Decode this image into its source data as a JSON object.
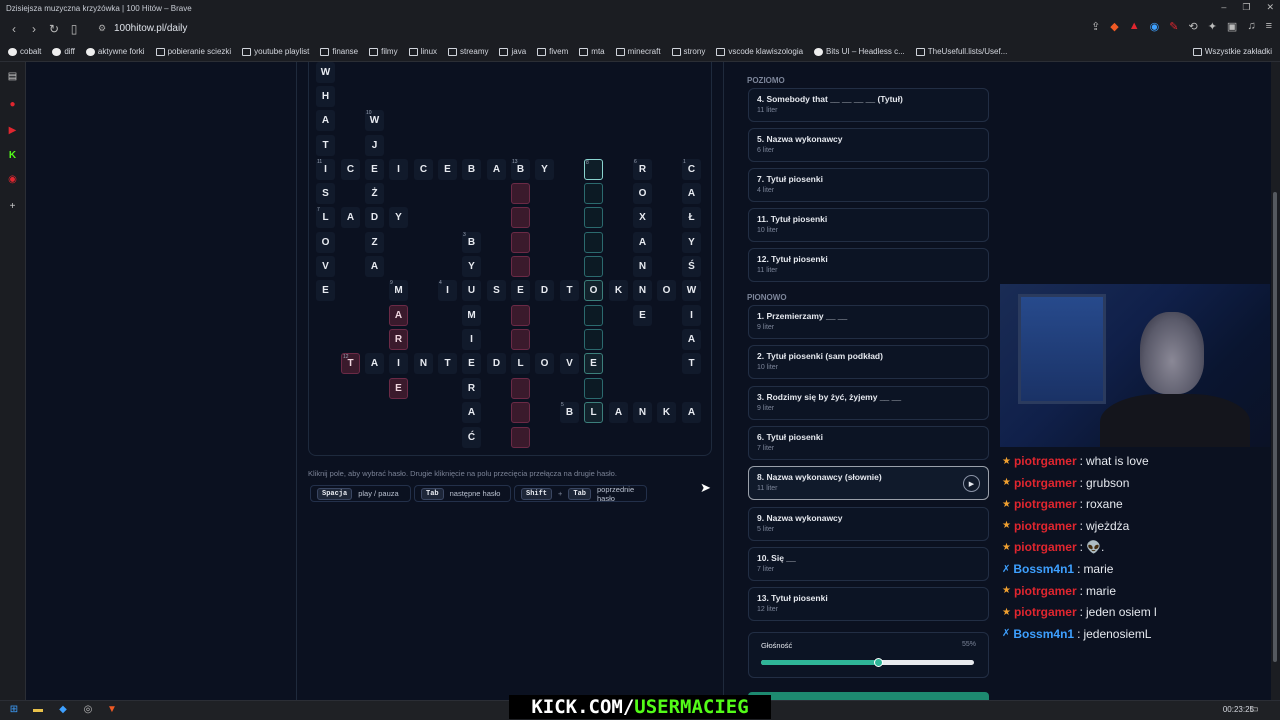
{
  "window": {
    "title": "Dzisiejsza muzyczna krzyżówka | 100 Hitów – Brave"
  },
  "address": {
    "url": "100hitow.pl/daily"
  },
  "bookmarks": [
    "cobalt",
    "diff",
    "aktywne forki",
    "pobieranie sciezki",
    "youtube playlist",
    "finanse",
    "filmy",
    "linux",
    "streamy",
    "java",
    "fivem",
    "mta",
    "minecraft",
    "strony",
    "vscode klawiszologia",
    "Bits UI – Headless c...",
    "TheUsefull.lists/Usef...",
    "Wszystkie zakładki"
  ],
  "grid": {
    "cells": [
      {
        "l": "W"
      },
      {
        "l": "H"
      },
      {
        "l": "A"
      },
      {
        "l": "T"
      },
      {
        "l": "W",
        "n": "10"
      },
      {
        "l": "J"
      },
      {
        "l": "I",
        "n": "11"
      },
      {
        "l": "C"
      },
      {
        "l": "E"
      },
      {
        "l": "I"
      },
      {
        "l": "C"
      },
      {
        "l": "E"
      },
      {
        "l": "B"
      },
      {
        "l": "A"
      },
      {
        "l": "B",
        "n": "13"
      },
      {
        "l": "Y"
      },
      {
        "l": "S"
      },
      {
        "l": "Ż"
      },
      {
        "l": "O"
      },
      {
        "l": "Z"
      },
      {
        "l": "V"
      },
      {
        "l": "A"
      },
      {
        "l": "E"
      },
      {
        "l": "L",
        "n": "7"
      },
      {
        "l": "A"
      },
      {
        "l": "D"
      },
      {
        "l": "Y"
      },
      {
        "l": "R",
        "n": "6"
      },
      {
        "l": "O"
      },
      {
        "l": "X"
      },
      {
        "l": "A"
      },
      {
        "l": "N"
      },
      {
        "l": "E"
      },
      {
        "l": "C",
        "n": "1"
      },
      {
        "l": "A"
      },
      {
        "l": "Ł"
      },
      {
        "l": "Y"
      },
      {
        "l": "Ś"
      },
      {
        "l": "W"
      },
      {
        "l": "I"
      },
      {
        "l": "A"
      },
      {
        "l": "T"
      },
      {
        "l": "B",
        "n": "3"
      },
      {
        "l": "Y"
      },
      {
        "l": "M"
      },
      {
        "l": "I"
      },
      {
        "l": "R"
      },
      {
        "l": "A"
      },
      {
        "l": "Ć"
      },
      {
        "l": "I",
        "n": "4"
      },
      {
        "l": "U"
      },
      {
        "l": "S"
      },
      {
        "l": "E"
      },
      {
        "l": "D"
      },
      {
        "l": "T"
      },
      {
        "l": "O"
      },
      {
        "l": "K"
      },
      {
        "l": "N"
      },
      {
        "l": "O"
      },
      {
        "l": "M",
        "n": "9"
      },
      {
        "l": "A"
      },
      {
        "l": "R"
      },
      {
        "l": "E"
      },
      {
        "l": "T",
        "n": "12"
      },
      {
        "l": "A"
      },
      {
        "l": "I"
      },
      {
        "l": "N"
      },
      {
        "l": "T"
      },
      {
        "l": "E"
      },
      {
        "l": "D"
      },
      {
        "l": "L"
      },
      {
        "l": "O"
      },
      {
        "l": "V"
      },
      {
        "l": "E"
      },
      {
        "l": "B",
        "n": "5"
      },
      {
        "l": "L"
      },
      {
        "l": "A"
      },
      {
        "l": "N"
      },
      {
        "l": "K"
      },
      {
        "l": "A"
      },
      {
        "l": "",
        "n": "8"
      }
    ]
  },
  "hint": "Kliknij pole, aby wybrać hasło. Drugie kliknięcie na polu przecięcia przełącza na drugie hasło.",
  "shortcuts": [
    {
      "keys": [
        "Spacja"
      ],
      "label": "play / pauza"
    },
    {
      "keys": [
        "Tab"
      ],
      "label": "następne hasło"
    },
    {
      "keys": [
        "Shift",
        "Tab"
      ],
      "label": "poprzednie hasło"
    }
  ],
  "clues": {
    "across_title": "POZIOMO",
    "across": [
      {
        "t": "4. Somebody that __ __ __ __ (Tytuł)",
        "s": "11 liter"
      },
      {
        "t": "5. Nazwa wykonawcy",
        "s": "6 liter"
      },
      {
        "t": "7. Tytuł piosenki",
        "s": "4 liter"
      },
      {
        "t": "11. Tytuł piosenki",
        "s": "10 liter"
      },
      {
        "t": "12. Tytuł piosenki",
        "s": "11 liter"
      }
    ],
    "down_title": "PIONOWO",
    "down": [
      {
        "t": "1. Przemierzamy __ __",
        "s": "9 liter"
      },
      {
        "t": "2. Tytuł piosenki (sam podkład)",
        "s": "10 liter"
      },
      {
        "t": "3. Rodzimy się by żyć, żyjemy __ __",
        "s": "9 liter"
      },
      {
        "t": "6. Tytuł piosenki",
        "s": "7 liter"
      },
      {
        "t": "8. Nazwa wykonawcy (słownie)",
        "s": "11 liter"
      },
      {
        "t": "9. Nazwa wykonawcy",
        "s": "5 liter"
      },
      {
        "t": "10. Się __",
        "s": "7 liter"
      },
      {
        "t": "13. Tytuł piosenki",
        "s": "12 liter"
      }
    ]
  },
  "volume": {
    "label": "Głośność",
    "value_text": "55%",
    "value": 0.55
  },
  "chat": [
    {
      "user": "piotrgamer",
      "text": "what is love",
      "color": "#e0262f",
      "icon": "★"
    },
    {
      "user": "piotrgamer",
      "text": "grubson",
      "color": "#e0262f",
      "icon": "★"
    },
    {
      "user": "piotrgamer",
      "text": "roxane",
      "color": "#e0262f",
      "icon": "★"
    },
    {
      "user": "piotrgamer",
      "text": "wjeżdża",
      "color": "#e0262f",
      "icon": "★"
    },
    {
      "user": "piotrgamer",
      "text": "👽.",
      "color": "#e0262f",
      "icon": "★"
    },
    {
      "user": "Bossm4n1",
      "text": "marie",
      "color": "#3ea0ff",
      "icon": "✗"
    },
    {
      "user": "piotrgamer",
      "text": "marie",
      "color": "#e0262f",
      "icon": "★"
    },
    {
      "user": "piotrgamer",
      "text": "jeden osiem l",
      "color": "#e0262f",
      "icon": "★"
    },
    {
      "user": "Bossm4n1",
      "text": "jedenosiemL",
      "color": "#3ea0ff",
      "icon": "✗"
    }
  ],
  "overlay": {
    "kick_a": "KICK.COM/",
    "kick_b": "USERMACIEG"
  },
  "clock": "00:23:25"
}
